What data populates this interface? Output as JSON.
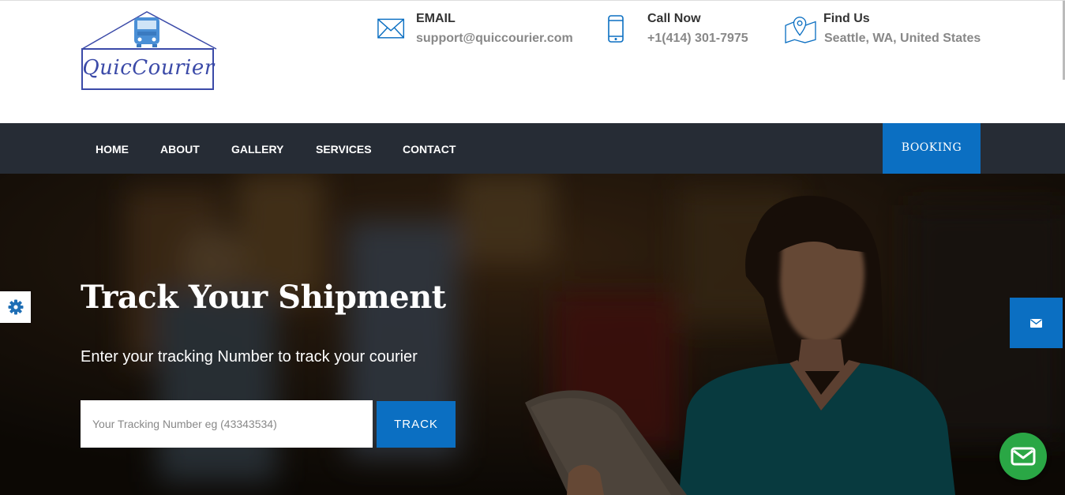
{
  "brand": {
    "logo_text": "QuicCourier"
  },
  "contact": [
    {
      "title": "EMAIL",
      "value": "support@quiccourier.com",
      "icon": "envelope-icon"
    },
    {
      "title": "Call Now",
      "value": "+1(414) 301-7975",
      "icon": "mobile-phone-icon"
    },
    {
      "title": "Find Us",
      "value": "Seattle, WA, United States",
      "icon": "map-pin-icon"
    }
  ],
  "nav": {
    "items": [
      {
        "label": "HOME"
      },
      {
        "label": "ABOUT"
      },
      {
        "label": "GALLERY"
      },
      {
        "label": "SERVICES"
      },
      {
        "label": "CONTACT"
      }
    ],
    "booking_label": "BOOKING"
  },
  "hero": {
    "title": "Track Your Shipment",
    "subtitle": "Enter your tracking Number to track your courier",
    "input_placeholder": "Your Tracking Number eg (43343534)",
    "input_value": "",
    "button_label": "TRACK"
  },
  "widgets": {
    "settings_icon": "gear-icon",
    "side_mail_icon": "envelope-icon",
    "chat_icon": "envelope-icon"
  },
  "colors": {
    "accent": "#0b6fc2",
    "nav_bg": "#262c35",
    "logo": "#3b4aa8",
    "chat": "#2aa745",
    "hero_overlay": "#24190f"
  }
}
